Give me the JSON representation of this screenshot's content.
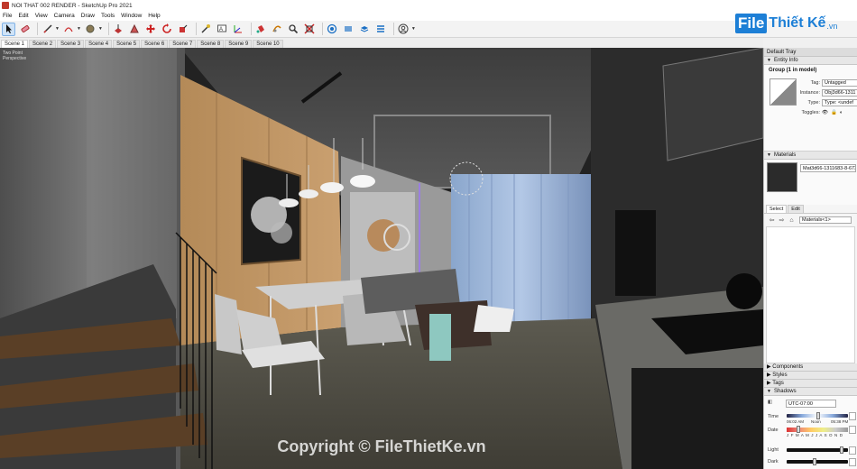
{
  "window": {
    "title": "NOI THAT 002 RENDER - SketchUp Pro 2021"
  },
  "menu": [
    "File",
    "Edit",
    "View",
    "Camera",
    "Draw",
    "Tools",
    "Window",
    "Help"
  ],
  "brand": {
    "file": "File",
    "rest": "Thiết Kế",
    "tld": ".vn"
  },
  "scenes": [
    "Scene 1",
    "Scene 2",
    "Scene 3",
    "Scene 4",
    "Scene 5",
    "Scene 6",
    "Scene 7",
    "Scene 8",
    "Scene 9",
    "Scene 10"
  ],
  "viewport": {
    "camera_label_1": "Two Point",
    "camera_label_2": "Perspective",
    "watermark": "Copyright © FileThietKe.vn"
  },
  "tray": {
    "title": "Default Tray",
    "entity_info": {
      "header": "Entity Info",
      "name": "Group (1 in model)",
      "tag_label": "Tag:",
      "tag_value": "Untagged",
      "instance_label": "Instance:",
      "instance_value": "Obj3d66-1311",
      "type_label": "Type:",
      "type_value": "Type: <undef",
      "toggles_label": "Toggles:"
    },
    "materials": {
      "header": "Materials",
      "name": "Mat3d66-1311683-8-673",
      "tab_select": "Select",
      "tab_edit": "Edit",
      "dropdown": "Materials<1>"
    },
    "components": "Components",
    "styles": "Styles",
    "tags": "Tags",
    "shadows": {
      "header": "Shadows",
      "timezone": "UTC-07:00",
      "time_label": "Time",
      "time_start": "06:02 AM",
      "time_noon": "Noon",
      "time_end": "05:38 PM",
      "date_label": "Date",
      "months": "J F M A M J J A S O N D",
      "light_label": "Light",
      "dark_label": "Dark"
    }
  }
}
